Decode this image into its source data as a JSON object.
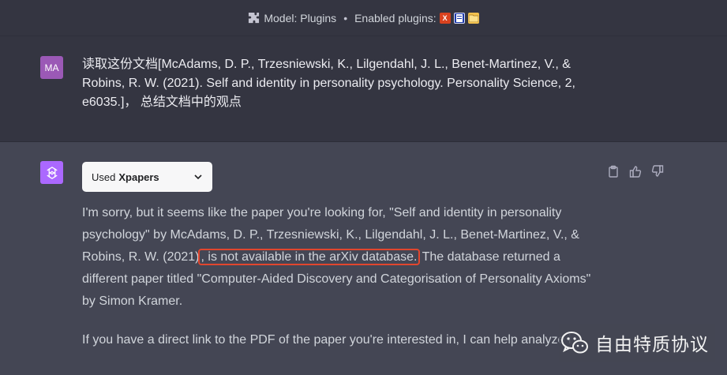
{
  "header": {
    "model_label": "Model: Plugins",
    "separator": "•",
    "enabled_label": "Enabled plugins:",
    "plugins": [
      {
        "icon": "x-plugin-icon",
        "glyph": "X",
        "color": "#d9421f"
      },
      {
        "icon": "document-plugin-icon",
        "glyph": "",
        "color": "#1e3aa8"
      },
      {
        "icon": "folder-plugin-icon",
        "glyph": "",
        "color": "#f2c14e"
      }
    ]
  },
  "user_message": {
    "avatar_initials": "MA",
    "avatar_color": "#9b59b6",
    "text": "读取这份文档[McAdams, D. P., Trzesniewski, K., Lilgendahl, J. L., Benet-Martinez, V., & Robins, R. W. (2021). Self and identity in personality psychology. Personality Science, 2, e6035.]， 总结文档中的观点"
  },
  "assistant_message": {
    "avatar_color": "#ab68ff",
    "plugin_used": {
      "prefix": "Used",
      "name": "Xpapers"
    },
    "actions": [
      "clipboard-icon",
      "thumbs-up-icon",
      "thumbs-down-icon"
    ],
    "paragraph1": {
      "before": "I'm sorry, but it seems like the paper you're looking for, \"Self and identity in personality psychology\" by McAdams, D. P., Trzesniewski, K., Lilgendahl, J. L., Benet-Martinez, V., & Robins, R. W. (2021)",
      "highlighted": ", is not available in the arXiv database.",
      "after": " The database returned a different paper titled \"Computer-Aided Discovery and Categorisation of Personality Axioms\" by Simon Kramer."
    },
    "paragraph2": "If you have a direct link to the PDF of the paper you're interested in, I can help analyze it."
  },
  "watermark": {
    "text": "自由特质协议",
    "icon": "wechat-icon"
  },
  "colors": {
    "background": "#444654",
    "user_row": "#343541",
    "highlight_border": "#e2462e"
  }
}
